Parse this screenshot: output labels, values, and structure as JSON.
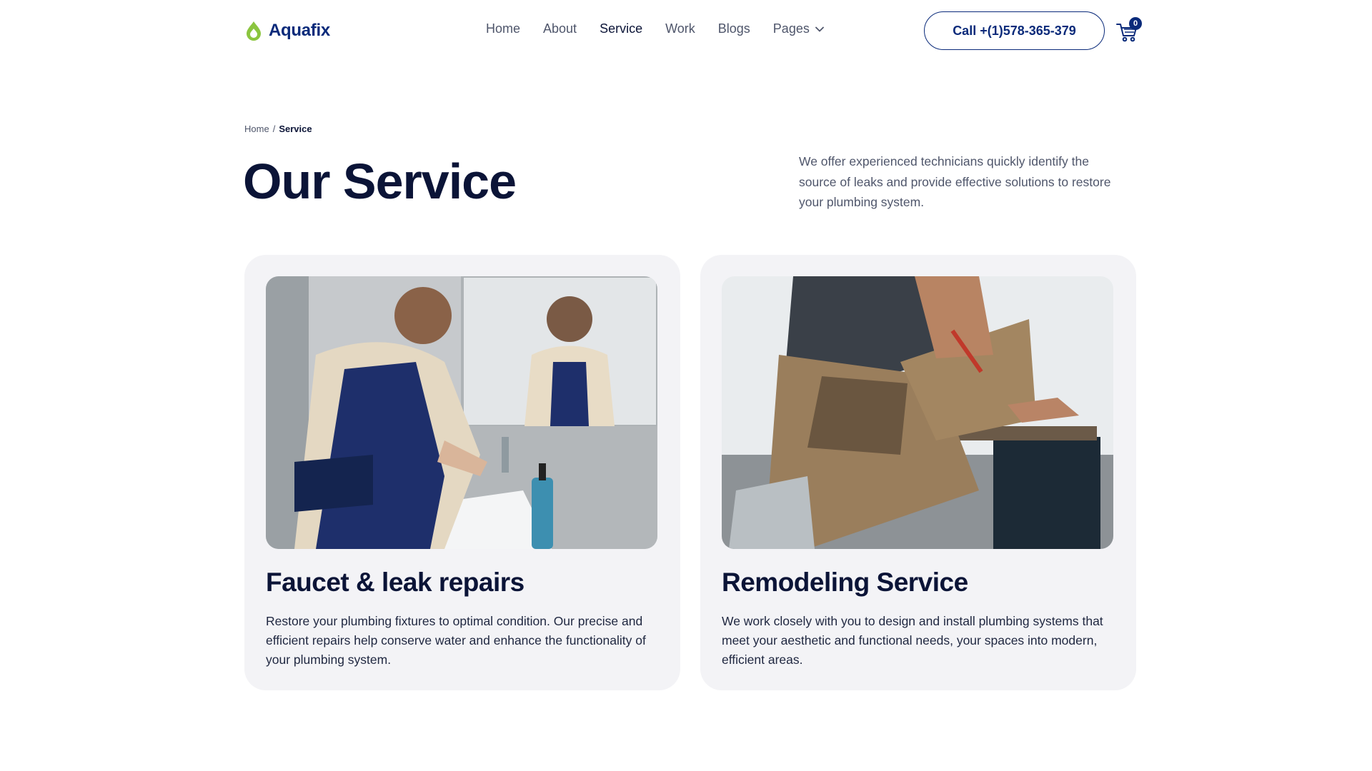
{
  "brand": {
    "name": "Aquafix",
    "accent": "#8bc53f",
    "primary": "#0a2a7a"
  },
  "nav": {
    "items": [
      {
        "label": "Home"
      },
      {
        "label": "About"
      },
      {
        "label": "Service"
      },
      {
        "label": "Work"
      },
      {
        "label": "Blogs"
      },
      {
        "label": "Pages"
      }
    ],
    "active": "Service"
  },
  "header": {
    "call_label": "Call +(1)578-365-379",
    "cart_count": "0",
    "cart_icon": "cart-icon"
  },
  "breadcrumb": {
    "home": "Home",
    "separator": "/",
    "current": "Service"
  },
  "hero": {
    "title": "Our Service",
    "intro": "We offer experienced technicians quickly identify the source of leaks and provide effective solutions to restore your plumbing system."
  },
  "services": [
    {
      "title": "Faucet & leak repairs",
      "text": "Restore your plumbing fixtures to optimal condition. Our precise and efficient repairs help conserve water and enhance the functionality of your plumbing system."
    },
    {
      "title": "Remodeling Service",
      "text": "We work closely with you to design and install plumbing systems that meet your aesthetic and functional needs, your spaces into modern, efficient areas."
    }
  ]
}
